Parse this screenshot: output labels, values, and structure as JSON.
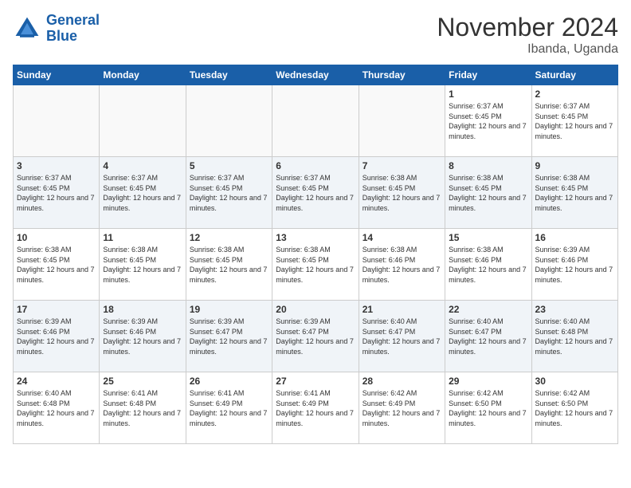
{
  "header": {
    "logo_line1": "General",
    "logo_line2": "Blue",
    "month": "November 2024",
    "location": "Ibanda, Uganda"
  },
  "days_of_week": [
    "Sunday",
    "Monday",
    "Tuesday",
    "Wednesday",
    "Thursday",
    "Friday",
    "Saturday"
  ],
  "weeks": [
    [
      {
        "day": "",
        "info": ""
      },
      {
        "day": "",
        "info": ""
      },
      {
        "day": "",
        "info": ""
      },
      {
        "day": "",
        "info": ""
      },
      {
        "day": "",
        "info": ""
      },
      {
        "day": "1",
        "info": "Sunrise: 6:37 AM\nSunset: 6:45 PM\nDaylight: 12 hours and 7 minutes."
      },
      {
        "day": "2",
        "info": "Sunrise: 6:37 AM\nSunset: 6:45 PM\nDaylight: 12 hours and 7 minutes."
      }
    ],
    [
      {
        "day": "3",
        "info": "Sunrise: 6:37 AM\nSunset: 6:45 PM\nDaylight: 12 hours and 7 minutes."
      },
      {
        "day": "4",
        "info": "Sunrise: 6:37 AM\nSunset: 6:45 PM\nDaylight: 12 hours and 7 minutes."
      },
      {
        "day": "5",
        "info": "Sunrise: 6:37 AM\nSunset: 6:45 PM\nDaylight: 12 hours and 7 minutes."
      },
      {
        "day": "6",
        "info": "Sunrise: 6:37 AM\nSunset: 6:45 PM\nDaylight: 12 hours and 7 minutes."
      },
      {
        "day": "7",
        "info": "Sunrise: 6:38 AM\nSunset: 6:45 PM\nDaylight: 12 hours and 7 minutes."
      },
      {
        "day": "8",
        "info": "Sunrise: 6:38 AM\nSunset: 6:45 PM\nDaylight: 12 hours and 7 minutes."
      },
      {
        "day": "9",
        "info": "Sunrise: 6:38 AM\nSunset: 6:45 PM\nDaylight: 12 hours and 7 minutes."
      }
    ],
    [
      {
        "day": "10",
        "info": "Sunrise: 6:38 AM\nSunset: 6:45 PM\nDaylight: 12 hours and 7 minutes."
      },
      {
        "day": "11",
        "info": "Sunrise: 6:38 AM\nSunset: 6:45 PM\nDaylight: 12 hours and 7 minutes."
      },
      {
        "day": "12",
        "info": "Sunrise: 6:38 AM\nSunset: 6:45 PM\nDaylight: 12 hours and 7 minutes."
      },
      {
        "day": "13",
        "info": "Sunrise: 6:38 AM\nSunset: 6:45 PM\nDaylight: 12 hours and 7 minutes."
      },
      {
        "day": "14",
        "info": "Sunrise: 6:38 AM\nSunset: 6:46 PM\nDaylight: 12 hours and 7 minutes."
      },
      {
        "day": "15",
        "info": "Sunrise: 6:38 AM\nSunset: 6:46 PM\nDaylight: 12 hours and 7 minutes."
      },
      {
        "day": "16",
        "info": "Sunrise: 6:39 AM\nSunset: 6:46 PM\nDaylight: 12 hours and 7 minutes."
      }
    ],
    [
      {
        "day": "17",
        "info": "Sunrise: 6:39 AM\nSunset: 6:46 PM\nDaylight: 12 hours and 7 minutes."
      },
      {
        "day": "18",
        "info": "Sunrise: 6:39 AM\nSunset: 6:46 PM\nDaylight: 12 hours and 7 minutes."
      },
      {
        "day": "19",
        "info": "Sunrise: 6:39 AM\nSunset: 6:47 PM\nDaylight: 12 hours and 7 minutes."
      },
      {
        "day": "20",
        "info": "Sunrise: 6:39 AM\nSunset: 6:47 PM\nDaylight: 12 hours and 7 minutes."
      },
      {
        "day": "21",
        "info": "Sunrise: 6:40 AM\nSunset: 6:47 PM\nDaylight: 12 hours and 7 minutes."
      },
      {
        "day": "22",
        "info": "Sunrise: 6:40 AM\nSunset: 6:47 PM\nDaylight: 12 hours and 7 minutes."
      },
      {
        "day": "23",
        "info": "Sunrise: 6:40 AM\nSunset: 6:48 PM\nDaylight: 12 hours and 7 minutes."
      }
    ],
    [
      {
        "day": "24",
        "info": "Sunrise: 6:40 AM\nSunset: 6:48 PM\nDaylight: 12 hours and 7 minutes."
      },
      {
        "day": "25",
        "info": "Sunrise: 6:41 AM\nSunset: 6:48 PM\nDaylight: 12 hours and 7 minutes."
      },
      {
        "day": "26",
        "info": "Sunrise: 6:41 AM\nSunset: 6:49 PM\nDaylight: 12 hours and 7 minutes."
      },
      {
        "day": "27",
        "info": "Sunrise: 6:41 AM\nSunset: 6:49 PM\nDaylight: 12 hours and 7 minutes."
      },
      {
        "day": "28",
        "info": "Sunrise: 6:42 AM\nSunset: 6:49 PM\nDaylight: 12 hours and 7 minutes."
      },
      {
        "day": "29",
        "info": "Sunrise: 6:42 AM\nSunset: 6:50 PM\nDaylight: 12 hours and 7 minutes."
      },
      {
        "day": "30",
        "info": "Sunrise: 6:42 AM\nSunset: 6:50 PM\nDaylight: 12 hours and 7 minutes."
      }
    ]
  ]
}
